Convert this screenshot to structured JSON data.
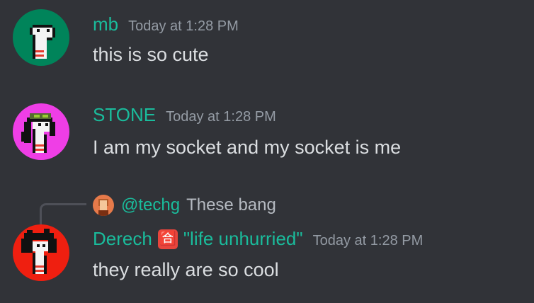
{
  "messages": [
    {
      "username": "mb",
      "timestamp": "Today at 1:28 PM",
      "content": "this is so cute",
      "avatar_bg": "#00845a"
    },
    {
      "username": "STONE",
      "timestamp": "Today at 1:28 PM",
      "content": "I am my socket and my socket is me",
      "avatar_bg": "#ef3ee6"
    },
    {
      "reply": {
        "username": "@techg",
        "text": "These bang"
      },
      "username": "Derech",
      "role_icon": "🈴",
      "status": "\"life unhurried\"",
      "timestamp": "Today at 1:28 PM",
      "content": "they really are so cool",
      "avatar_bg": "#ef1f10"
    }
  ],
  "colors": {
    "background": "#313338",
    "username": "#1abc9c",
    "timestamp": "#949ba4",
    "text": "#dbdee1"
  },
  "icons": [
    "avatar-dino-icon",
    "reply-spine-icon",
    "role-icon"
  ]
}
